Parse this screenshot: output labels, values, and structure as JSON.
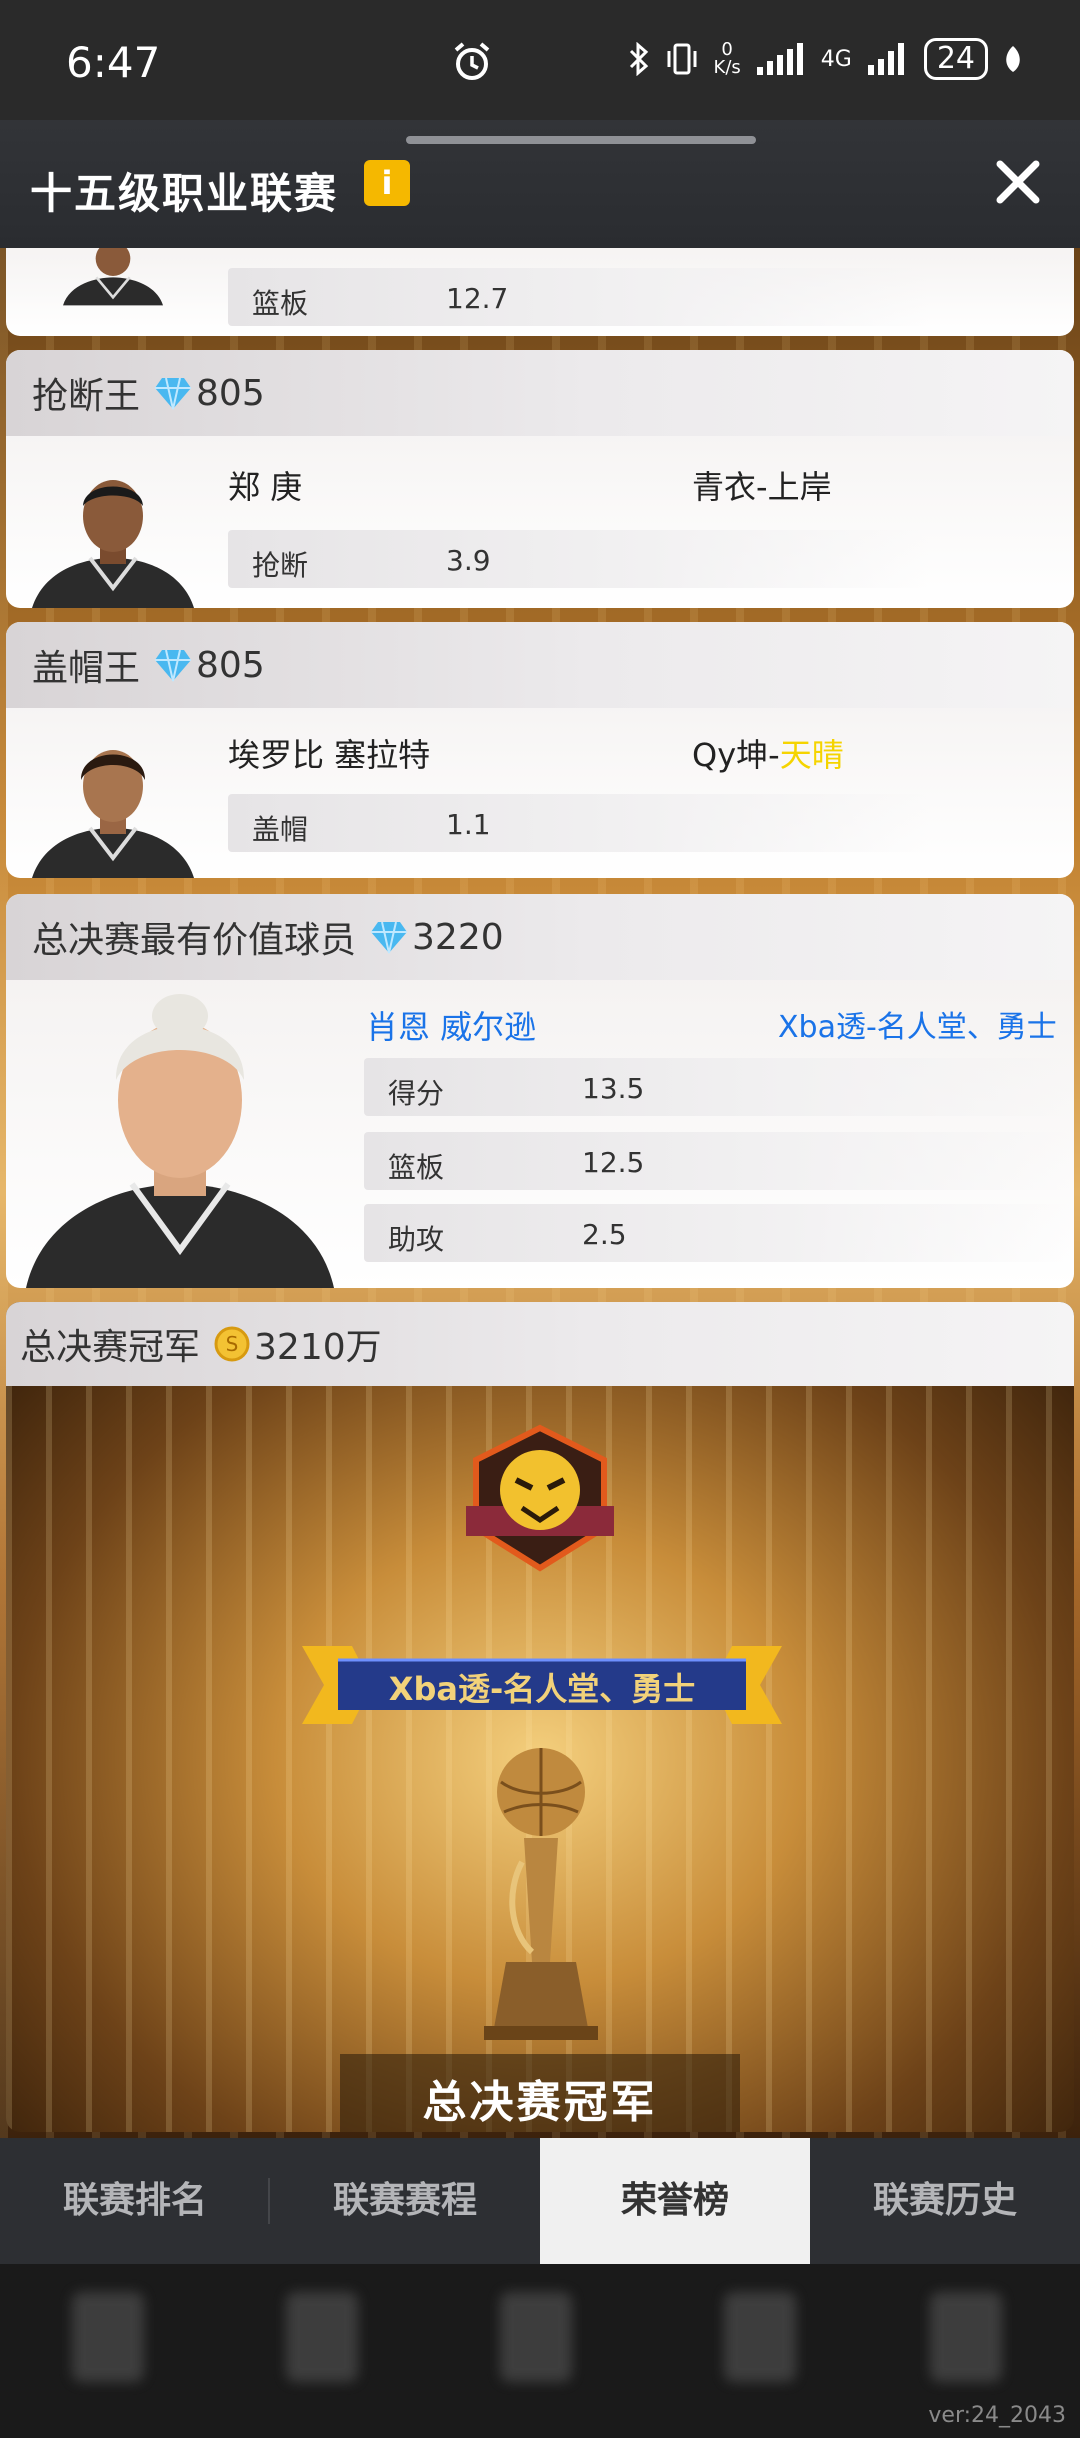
{
  "status_bar": {
    "time": "6:47",
    "net_speed_value": "0",
    "net_speed_unit": "K/s",
    "network": "4G",
    "battery": "24"
  },
  "header": {
    "title": "十五级职业联赛",
    "info_label": "i"
  },
  "top_partial": {
    "stat_label": "篮板",
    "stat_value": "12.7"
  },
  "awards": [
    {
      "title": "抢断王",
      "reward": "805",
      "player": "郑 庚",
      "team_prefix": "青衣-",
      "team_suffix": "上岸",
      "stat_label": "抢断",
      "stat_value": "3.9"
    },
    {
      "title": "盖帽王",
      "reward": "805",
      "player": "埃罗比 塞拉特",
      "team_prefix": "Qy坤-",
      "team_suffix": "天晴",
      "stat_label": "盖帽",
      "stat_value": "1.1"
    }
  ],
  "mvp": {
    "title": "总决赛最有价值球员",
    "reward": "3220",
    "player": "肖恩 威尔逊",
    "team": "Xba透-名人堂、勇士",
    "stats": [
      {
        "label": "得分",
        "value": "13.5"
      },
      {
        "label": "篮板",
        "value": "12.5"
      },
      {
        "label": "助攻",
        "value": "2.5"
      }
    ]
  },
  "champion": {
    "title": "总决赛冠军",
    "reward": "3210万",
    "team": "Xba透-名人堂、勇士",
    "caption": "总决赛冠军"
  },
  "tabs": [
    "联赛排名",
    "联赛赛程",
    "荣誉榜",
    "联赛历史"
  ],
  "version": "ver:24_2043",
  "colors": {
    "accent_blue": "#1a73e8",
    "highlight_yellow": "#f5d400",
    "info_badge": "#f5b800"
  }
}
